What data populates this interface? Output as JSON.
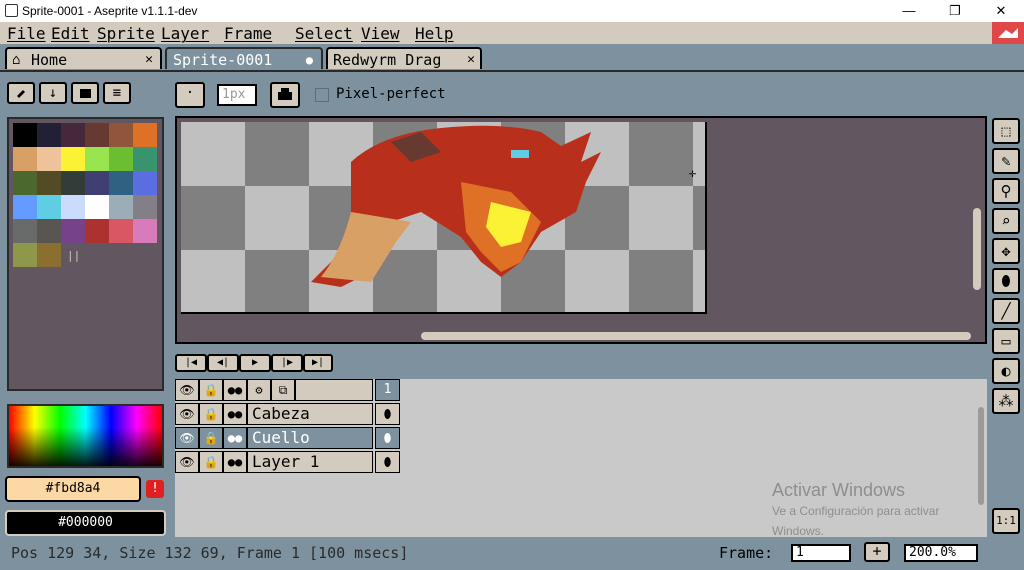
{
  "window": {
    "title": "Sprite-0001 - Aseprite v1.1.1-dev",
    "minimize": "—",
    "maximize": "❐",
    "close": "✕"
  },
  "menu": {
    "items": [
      "File",
      "Edit",
      "Sprite",
      "Layer",
      "Frame",
      "Select",
      "View",
      "Help"
    ]
  },
  "tabs": [
    {
      "label": "Home",
      "icon": "home-icon",
      "close": "✕",
      "active": false
    },
    {
      "label": "Sprite-0001",
      "icon": "",
      "close": "●",
      "active": true
    },
    {
      "label": "Redwyrm Drag",
      "icon": "",
      "close": "✕",
      "active": false
    }
  ],
  "context_bar": {
    "brush_size": "1px",
    "pixel_perfect_label": "Pixel-perfect"
  },
  "palette_toolbar": {
    "buttons": [
      "edit-icon",
      "down-arrow-icon",
      "folder-icon",
      "menu-icon"
    ]
  },
  "palette": {
    "colors": [
      "#000000",
      "#222034",
      "#45283c",
      "#663931",
      "#8f563b",
      "#df7126",
      "#d9a066",
      "#eec39a",
      "#fbf236",
      "#99e550",
      "#6abe30",
      "#37946e",
      "#4b692f",
      "#524b24",
      "#323c39",
      "#3f3f74",
      "#306082",
      "#5b6ee1",
      "#639bff",
      "#5fcde4",
      "#cbdbfc",
      "#ffffff",
      "#9badb7",
      "#847e87",
      "#696a6a",
      "#595652",
      "#76428a",
      "#ac3232",
      "#d95763",
      "#d77bba",
      "#8f974a",
      "#8a6f30"
    ]
  },
  "colors": {
    "foreground": "#fbd8a4",
    "foreground_label": "#fbd8a4",
    "background": "#000000",
    "background_label": "#000000",
    "warning_icon": "!"
  },
  "timeline": {
    "nav_buttons": [
      "first-frame-icon",
      "prev-frame-icon",
      "play-icon",
      "next-frame-icon",
      "last-frame-icon"
    ],
    "frame_header": "1",
    "layers": [
      {
        "name": "Cabeza",
        "selected": false
      },
      {
        "name": "Cuello",
        "selected": true
      },
      {
        "name": "Layer 1",
        "selected": false
      }
    ]
  },
  "tools": [
    "rectangle-marquee-icon",
    "pencil-icon",
    "eyedropper-icon",
    "zoom-icon",
    "move-icon",
    "paint-bucket-icon",
    "line-icon",
    "rectangle-icon",
    "contour-icon",
    "spray-icon"
  ],
  "zoom_reset": "1:1",
  "watermark": {
    "title": "Activar Windows",
    "subtitle": "Ve a Configuración para activar Windows."
  },
  "status_bar": {
    "info": "Pos 129 34, Size 132 69, Frame 1 [100 msecs]",
    "frame_label": "Frame:",
    "frame_value": "1",
    "add_frame": "+",
    "zoom": "200.0%"
  }
}
